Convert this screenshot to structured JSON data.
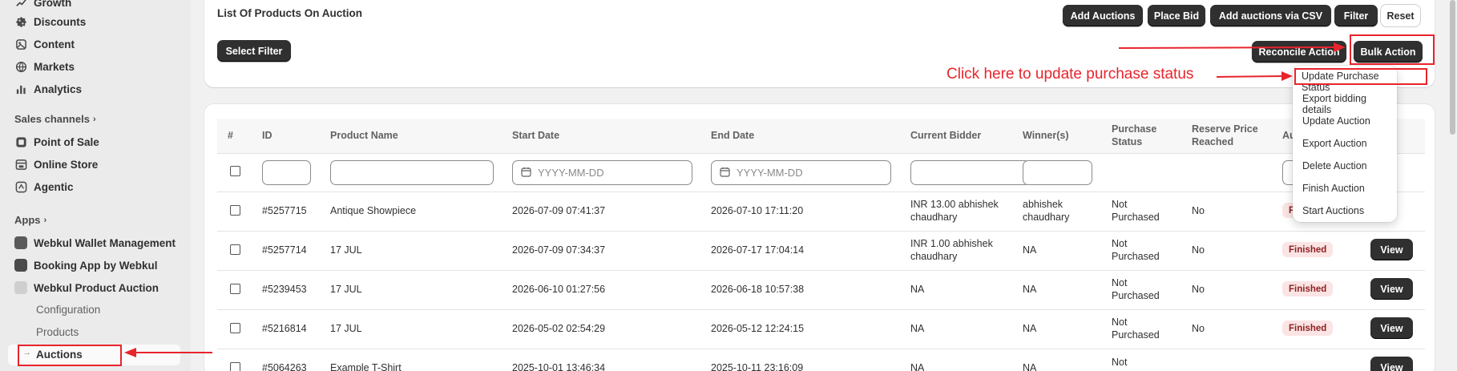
{
  "sidebar": {
    "top_items": [
      {
        "label": "Growth",
        "icon": "growth-icon"
      },
      {
        "label": "Discounts",
        "icon": "discount-icon"
      },
      {
        "label": "Content",
        "icon": "content-icon"
      },
      {
        "label": "Markets",
        "icon": "globe-icon"
      },
      {
        "label": "Analytics",
        "icon": "bar-chart-icon"
      }
    ],
    "sales_channels_label": "Sales channels",
    "channels": [
      {
        "label": "Point of Sale"
      },
      {
        "label": "Online Store"
      },
      {
        "label": "Agentic"
      }
    ],
    "apps_label": "Apps",
    "apps": [
      {
        "label": "Webkul Wallet Management"
      },
      {
        "label": "Booking App by Webkul"
      },
      {
        "label": "Webkul Product Auction"
      }
    ],
    "sub_items": [
      {
        "label": "Configuration"
      },
      {
        "label": "Products"
      },
      {
        "label": "Auctions"
      }
    ]
  },
  "header": {
    "title": "List Of Products On Auction",
    "buttons": {
      "add_auctions": "Add Auctions",
      "place_bid": "Place Bid",
      "add_csv": "Add auctions via CSV",
      "filter": "Filter",
      "reset": "Reset"
    },
    "select_filter": "Select Filter",
    "reconcile_action": "Reconcile Action",
    "bulk_action": "Bulk Action"
  },
  "annotation": {
    "instruction": "Click here to update purchase status"
  },
  "dropdown": {
    "items": [
      "Update Purchase Status",
      "Export bidding details",
      "Update Auction",
      "Export Auction",
      "Delete Auction",
      "Finish Auction",
      "Start Auctions"
    ]
  },
  "table": {
    "columns": {
      "hash": "#",
      "id": "ID",
      "name": "Product Name",
      "start": "Start Date",
      "end": "End Date",
      "bidder": "Current Bidder",
      "winner": "Winner(s)",
      "purchase_l1": "Purchase",
      "purchase_l2": "Status",
      "reserve_l1": "Reserve Price",
      "reserve_l2": "Reached",
      "status_partial": "Au"
    },
    "date_placeholder": "YYYY-MM-DD",
    "rows": [
      {
        "id": "#5257715",
        "name": "Antique Showpiece",
        "start": "2026-07-09 07:41:37",
        "end": "2026-07-10 17:11:20",
        "bidder_l1": "INR 13.00 abhishek",
        "bidder_l2": "chaudhary",
        "winner_l1": "abhishek",
        "winner_l2": "chaudhary",
        "purchase_l1": "Not",
        "purchase_l2": "Purchased",
        "reserve": "No",
        "status": "F",
        "view": ""
      },
      {
        "id": "#5257714",
        "name": "17 JUL",
        "start": "2026-07-09 07:34:37",
        "end": "2026-07-17 17:04:14",
        "bidder_l1": "INR 1.00 abhishek",
        "bidder_l2": "chaudhary",
        "winner_l1": "NA",
        "winner_l2": "",
        "purchase_l1": "Not",
        "purchase_l2": "Purchased",
        "reserve": "No",
        "status": "Finished",
        "view": "View"
      },
      {
        "id": "#5239453",
        "name": "17 JUL",
        "start": "2026-06-10 01:27:56",
        "end": "2026-06-18 10:57:38",
        "bidder_l1": "NA",
        "bidder_l2": "",
        "winner_l1": "NA",
        "winner_l2": "",
        "purchase_l1": "Not",
        "purchase_l2": "Purchased",
        "reserve": "No",
        "status": "Finished",
        "view": "View"
      },
      {
        "id": "#5216814",
        "name": "17 JUL",
        "start": "2026-05-02 02:54:29",
        "end": "2026-05-12 12:24:15",
        "bidder_l1": "NA",
        "bidder_l2": "",
        "winner_l1": "NA",
        "winner_l2": "",
        "purchase_l1": "Not",
        "purchase_l2": "Purchased",
        "reserve": "No",
        "status": "Finished",
        "view": "View"
      },
      {
        "id": "#5064263",
        "name": "Example T-Shirt",
        "start": "2025-10-01 13:46:34",
        "end": "2025-10-11 23:16:09",
        "bidder_l1": "NA",
        "bidder_l2": "",
        "winner_l1": "NA",
        "winner_l2": "",
        "purchase_l1": "Not",
        "purchase_l2": "",
        "reserve": "",
        "status": "",
        "view": "View"
      }
    ]
  },
  "colors": {
    "annotation_red": "#e8242c",
    "dark_button": "#303030",
    "badge_bg": "#fbe4e4",
    "badge_text": "#8e1f1f"
  }
}
